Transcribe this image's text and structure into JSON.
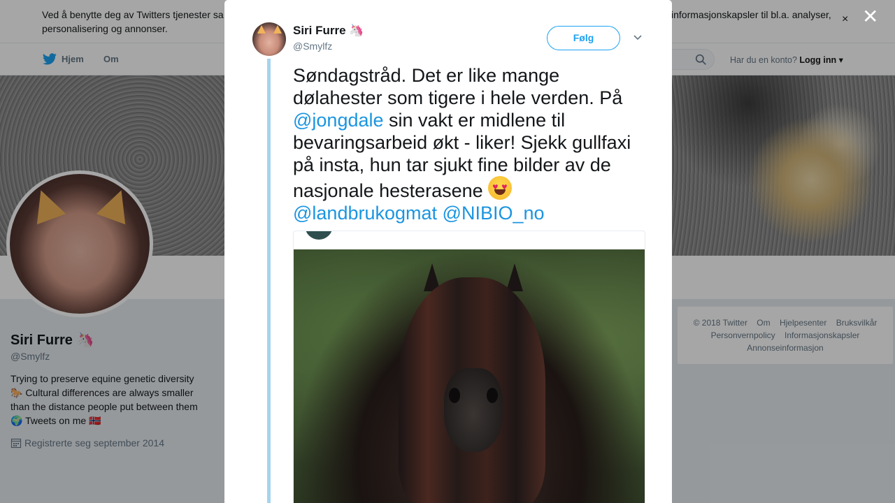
{
  "cookie_banner": {
    "text": "Ved å benytte deg av Twitters tjenester sa                                                                                                                                                              informasjonskapsler til bl.a. analyser, personalisering og annonser.",
    "text_left": "Ved å benytte deg av Twitters tjenester sa",
    "text_right": "informasjonskapsler til bl.a. analyser,",
    "text_line2": "personalisering og annonser.",
    "close": "×"
  },
  "nav": {
    "home": "Hjem",
    "about": "Om",
    "account_question": "Har du en konto?",
    "login": "Logg inn"
  },
  "profile": {
    "name": "Siri Furre",
    "handle": "@Smylfz",
    "bio_line1": "Trying to preserve equine genetic diversity",
    "bio_line2": "🐎 Cultural differences are always smaller",
    "bio_line3": "than the distance people put between them",
    "bio_line4": "🌍 Tweets on me 🇳🇴",
    "joined": "Registrerte seg september 2014"
  },
  "footer": {
    "copyright": "© 2018 Twitter",
    "about": "Om",
    "help": "Hjelpesenter",
    "terms": "Bruksvilkår",
    "privacy": "Personvernpolicy",
    "cookies": "Informasjonskapsler",
    "ads": "Annonseinformasjon"
  },
  "modal": {
    "close": "✕",
    "author_name": "Siri Furre",
    "author_emoji": "🦄",
    "author_handle": "@Smylfz",
    "follow_label": "Følg",
    "tweet": {
      "part1": "Søndagstråd. Det er like mange dølahester som tigere i hele verden. På ",
      "mention1": "@jongdale",
      "part2": " sin vakt er midlene til bevaringsarbeid økt - liker! Sjekk gullfaxi på insta, hun tar sjukt fine bilder av de nasjonale hesterasene ",
      "mention2": "@landbrukogmat",
      "mention3": "@NIBIO_no"
    }
  },
  "colors": {
    "accent": "#1da1f2",
    "link": "#1b95e0",
    "thread_line": "#a6d4ec"
  }
}
